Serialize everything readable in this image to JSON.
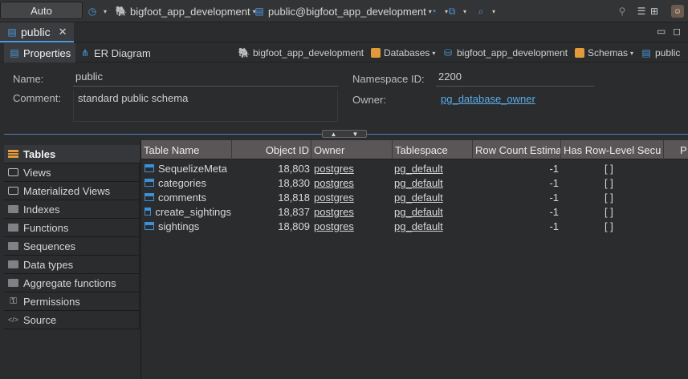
{
  "toolbar": {
    "auto_label": "Auto",
    "connection": "bigfoot_app_development",
    "schema": "public@bigfoot_app_development"
  },
  "editor": {
    "tab_title": "public"
  },
  "subtabs": {
    "properties": "Properties",
    "er_diagram": "ER Diagram"
  },
  "breadcrumbs": [
    "bigfoot_app_development",
    "Databases",
    "bigfoot_app_development",
    "Schemas",
    "public"
  ],
  "properties": {
    "name_label": "Name:",
    "name_value": "public",
    "comment_label": "Comment:",
    "comment_value": "standard public schema",
    "namespace_label": "Namespace ID:",
    "namespace_value": "2200",
    "owner_label": "Owner:",
    "owner_value": "pg_database_owner"
  },
  "nav": {
    "items": [
      "Tables",
      "Views",
      "Materialized Views",
      "Indexes",
      "Functions",
      "Sequences",
      "Data types",
      "Aggregate functions",
      "Permissions",
      "Source"
    ]
  },
  "table": {
    "columns": [
      "Table Name",
      "Object ID",
      "Owner",
      "Tablespace",
      "Row Count Estima",
      "Has Row-Level Secu",
      "P"
    ],
    "rows": [
      {
        "name": "SequelizeMeta",
        "oid": "18,803",
        "owner": "postgres",
        "space": "pg_default",
        "rows": "-1",
        "rls": "[ ]"
      },
      {
        "name": "categories",
        "oid": "18,830",
        "owner": "postgres",
        "space": "pg_default",
        "rows": "-1",
        "rls": "[ ]"
      },
      {
        "name": "comments",
        "oid": "18,818",
        "owner": "postgres",
        "space": "pg_default",
        "rows": "-1",
        "rls": "[ ]"
      },
      {
        "name": "create_sightings",
        "oid": "18,837",
        "owner": "postgres",
        "space": "pg_default",
        "rows": "-1",
        "rls": "[ ]"
      },
      {
        "name": "sightings",
        "oid": "18,809",
        "owner": "postgres",
        "space": "pg_default",
        "rows": "-1",
        "rls": "[ ]"
      }
    ]
  }
}
